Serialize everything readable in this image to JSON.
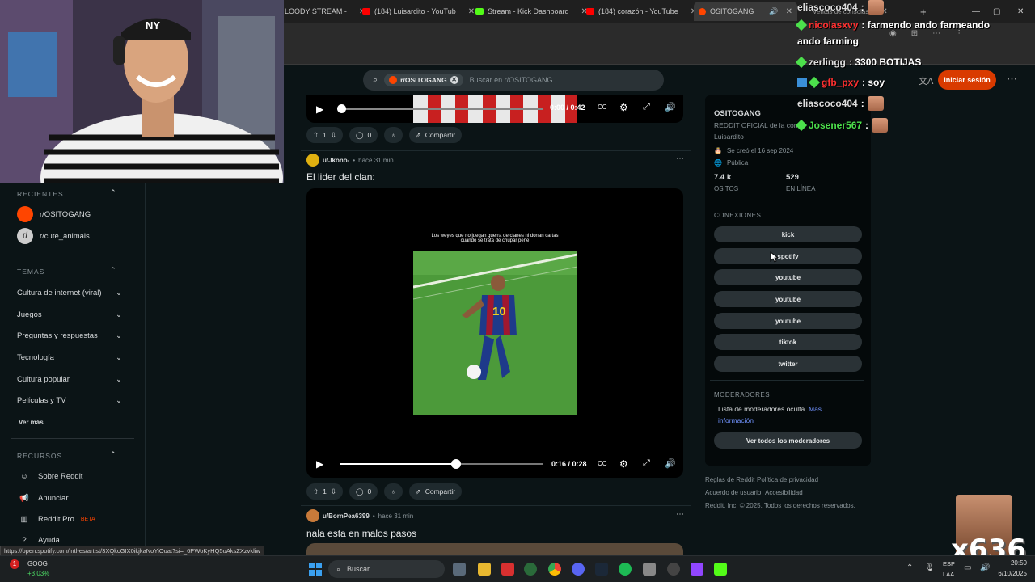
{
  "browser": {
    "tabs": [
      {
        "label": "LOODY STREAM -",
        "color": "#a0a0a0"
      },
      {
        "label": "(184) Luisardito - YouTub",
        "color": "#ff0000"
      },
      {
        "label": "Stream - Kick Dashboard",
        "color": "#53fc18"
      },
      {
        "label": "(184) corazón - YouTube",
        "color": "#ff0000"
      },
      {
        "label": "OSITOGANG",
        "color": "#ff4500"
      },
      {
        "label": "Ventas de consolas",
        "color": "#777777"
      }
    ],
    "status_url": "https://open.spotify.com/intl-es/artist/3XQkcGIX0ikjkaNoYiOuat?si=_6PWoKyHQ5uAksZXzvkliw"
  },
  "header": {
    "search_chip": "r/OSITOGANG",
    "search_placeholder": "Buscar en r/OSITOGANG",
    "login_label": "Iniciar sesión"
  },
  "sidebar": {
    "recientes_title": "RECIENTES",
    "recent": [
      {
        "label": "r/OSITOGANG",
        "color": "#ff4500"
      },
      {
        "label": "r/cute_animals",
        "color": "#555555"
      }
    ],
    "temas_title": "TEMAS",
    "temas": [
      "Cultura de internet (viral)",
      "Juegos",
      "Preguntas y respuestas",
      "Tecnología",
      "Cultura popular",
      "Películas y TV"
    ],
    "ver_mas": "Ver más",
    "recursos_title": "RECURSOS",
    "recursos": [
      "Sobre Reddit",
      "Anunciar",
      "Reddit Pro",
      "Ayuda"
    ],
    "beta": "BETA"
  },
  "posts": [
    {
      "video_time": "0:00 / 0:42",
      "votes": "1",
      "comments": "0",
      "share": "Compartir"
    },
    {
      "author": "u/Jkono-",
      "time": "hace 31 min",
      "title": "El lider del clan:",
      "caption_line1": "Los weyes que no juegan guerra de clanes ni donan cartas",
      "caption_line2": "cuando se trata de chupar pene",
      "jersey": "10",
      "video_time": "0:16 / 0:28",
      "progress": 0.57,
      "votes": "1",
      "comments": "0",
      "share": "Compartir"
    },
    {
      "author": "u/BornPea6399",
      "time": "hace 31 min",
      "title": "nala esta en malos pasos"
    }
  ],
  "community": {
    "name": "OSITOGANG",
    "desc": "REDDIT OFICIAL de la com",
    "desc2": "Luisardito",
    "created": "Se creó el 16 sep 2024",
    "visibility": "Pública",
    "members": "7.4 k",
    "members_label": "OSITOS",
    "online": "529",
    "online_label": "EN LÍNEA",
    "connections_title": "CONEXIONES",
    "connections": [
      "kick",
      "spotify",
      "youtube",
      "youtube",
      "youtube",
      "tiktok",
      "twitter"
    ],
    "mods_title": "MODERADORES",
    "mods_text": "Lista de moderadores oculta.",
    "mods_link": "Más",
    "mods_link2": "información",
    "mods_button": "Ver todos los moderadores"
  },
  "footer": {
    "rules": "Reglas de Reddit",
    "privacy": "Política de privacidad",
    "agreement": "Acuerdo de usuario",
    "accessibility": "Accesibilidad",
    "copyright": "Reddit, Inc. © 2025. Todos los derechos reservados."
  },
  "chat": [
    {
      "user": "eliascoco404",
      "msg": ":",
      "color": "#ffffff"
    },
    {
      "user": "nicolasxvy",
      "msg": ": farmendo ando farmeando",
      "color": "#ff3030"
    },
    {
      "user": "",
      "msg": "ando farming",
      "color": "#ffffff"
    },
    {
      "user": "zerlingg",
      "msg": ": 3300 BOTIJAS",
      "color": "#ffffff"
    },
    {
      "user": "gfb_pxy",
      "msg": ": soy",
      "color": "#ff3030"
    },
    {
      "user": "eliascoco404",
      "msg": ":",
      "color": "#ffffff"
    },
    {
      "user": "Josener567",
      "msg": ":",
      "color": "#4ce04c"
    }
  ],
  "overlay": {
    "counter": "x636"
  },
  "taskbar": {
    "stock_name": "GOOG",
    "stock_change": "+3.03%",
    "search": "Buscar",
    "lang1": "ESP",
    "lang2": "LAA",
    "time": "20:50",
    "date": "6/10/2025"
  }
}
